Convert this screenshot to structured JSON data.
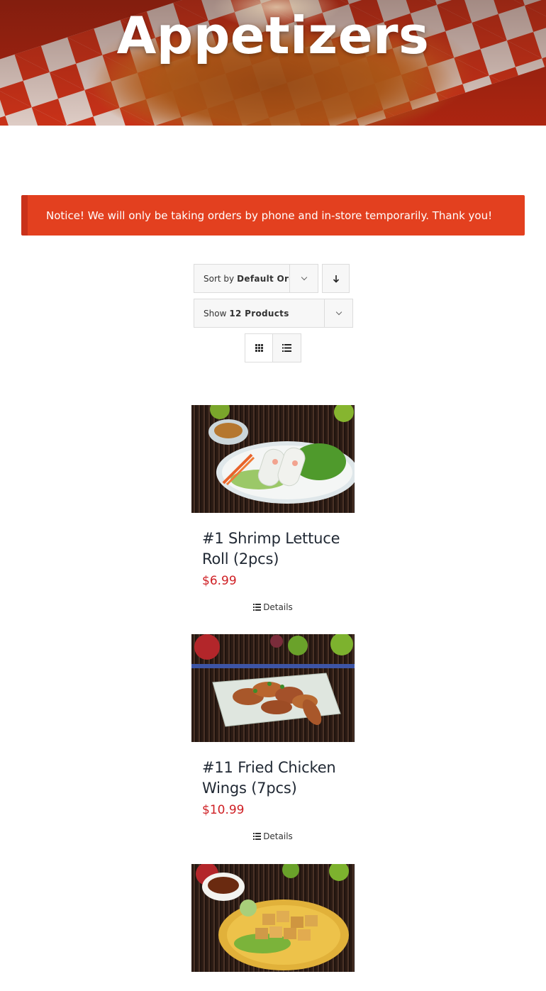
{
  "hero": {
    "title": "Appetizers"
  },
  "notice": {
    "text": "Notice! We will only be taking orders by phone and in-store temporarily. Thank you!"
  },
  "sort": {
    "label": "Sort by",
    "value": "Default Order",
    "direction_icon": "arrow-down-icon"
  },
  "show": {
    "label": "Show",
    "value": "12 Products"
  },
  "view": {
    "grid_icon": "grid-view-icon",
    "list_icon": "list-view-icon"
  },
  "products": [
    {
      "title": "#1 Shrimp Lettuce Roll (2pcs)",
      "price": "$6.99",
      "details_label": "Details"
    },
    {
      "title": "#11 Fried Chicken Wings (7pcs)",
      "price": "$10.99",
      "details_label": "Details"
    },
    {
      "title": "",
      "price": "",
      "details_label": ""
    }
  ],
  "colors": {
    "accent": "#e3401f",
    "price": "#cf1f24",
    "notice_border": "#c9311a"
  }
}
